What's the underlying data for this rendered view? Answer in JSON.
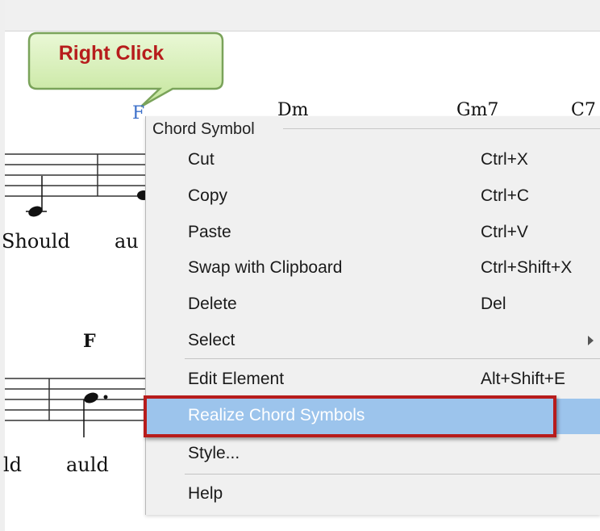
{
  "callout": {
    "text": "Right Click"
  },
  "score": {
    "chords": [
      "F",
      "Dm",
      "Gm7",
      "C7",
      "F"
    ],
    "lyrics": [
      "Should",
      "au",
      "ld",
      "auld"
    ]
  },
  "context_menu": {
    "title": "Chord Symbol",
    "items": [
      {
        "label": "Cut",
        "shortcut": "Ctrl+X"
      },
      {
        "label": "Copy",
        "shortcut": "Ctrl+C"
      },
      {
        "label": "Paste",
        "shortcut": "Ctrl+V"
      },
      {
        "label": "Swap with Clipboard",
        "shortcut": "Ctrl+Shift+X"
      },
      {
        "label": "Delete",
        "shortcut": "Del"
      },
      {
        "label": "Select",
        "shortcut": ""
      },
      {
        "label": "Edit Element",
        "shortcut": "Alt+Shift+E"
      },
      {
        "label": "Realize Chord Symbols",
        "shortcut": ""
      },
      {
        "label": "Style...",
        "shortcut": ""
      },
      {
        "label": "Help",
        "shortcut": ""
      }
    ],
    "highlighted_item": "Realize Chord Symbols"
  },
  "colors": {
    "highlight": "#9cc4ec",
    "annotation_red": "#b71c1c",
    "selected_chord": "#3b6fc9",
    "callout_green": "#d8f0b8"
  }
}
